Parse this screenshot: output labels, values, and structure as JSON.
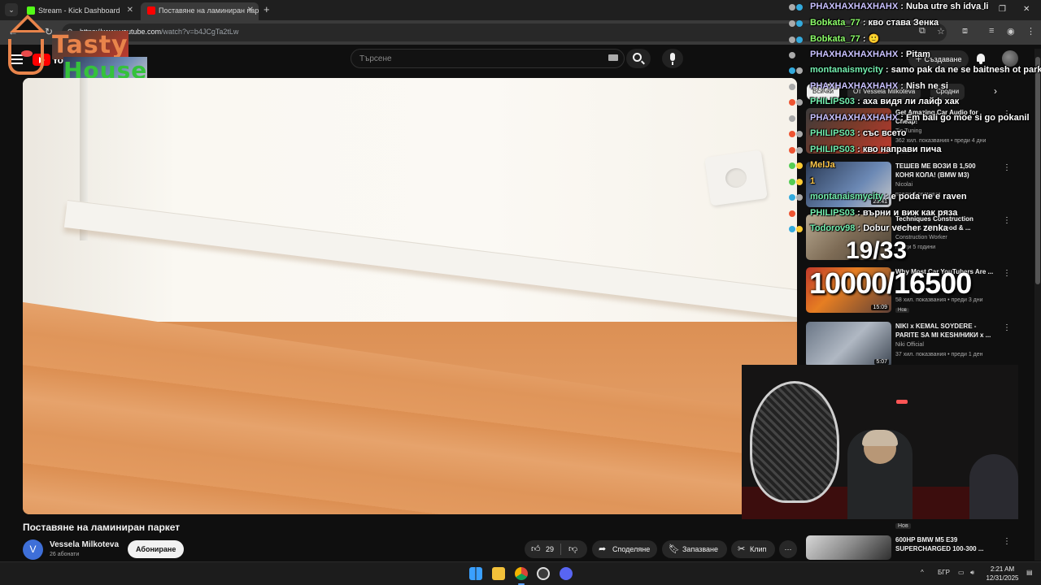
{
  "browser": {
    "tabs": [
      {
        "title": "Stream - Kick Dashboard",
        "color": "#53fc18"
      },
      {
        "title": "Поставяне на ламиниран парк",
        "color": "#ff0000"
      }
    ],
    "url_host": "https://www.youtube.com",
    "url_path": "/watch?v=b4JCgTa2tLw"
  },
  "youtube": {
    "logo_text": "YouTube",
    "search_placeholder": "Търсене",
    "create_label": "Създаване",
    "video": {
      "title": "Поставяне на ламиниран паркет",
      "channel": "Vessela Milkoteva",
      "channel_initial": "V",
      "subscribers": "26 абонати",
      "subscribe_label": "Абониране",
      "likes": "29",
      "share_label": "Споделяне",
      "save_label": "Запазване",
      "clip_label": "Клип"
    },
    "chips": [
      "Всички",
      "От Vessela Milkoteva",
      "Сродни"
    ],
    "recommendations": [
      {
        "title": "Get Amazing Car Audio for Cheap!",
        "channel": "Tie Tuning",
        "views": "362 хил. показвания",
        "age": "преди 4 дни",
        "duration": "",
        "badge": "Нов"
      },
      {
        "title": "ТЕШЕВ МЕ ВОЗИ В 1,500 КОНЯ КОЛА! (BMW M3)",
        "channel": "Nicolai",
        "views": "",
        "age": "преди 4 седмици",
        "duration": "23:41",
        "badge": ""
      },
      {
        "title": "Techniques Construction Workers With Wood & ...",
        "channel": "Construction Worker",
        "views": "",
        "age": "преди 5 години",
        "duration": "",
        "badge": ""
      },
      {
        "title": "Why Most Car YouTubers Are ...",
        "channel": "",
        "views": "58 хил. показвания",
        "age": "преди 3 дни",
        "duration": "15:09",
        "badge": "Нов"
      },
      {
        "title": "NIKI x KEMAL SOYDERE - PARITE SA MI KESH/НИКИ x ...",
        "channel": "Niki Official",
        "views": "37 хил. показвания",
        "age": "преди 1 ден",
        "duration": "5:07",
        "badge": ""
      },
      {
        "title": "600HP BMW M5 E39 SUPERCHARGED 100-300 ...",
        "channel": "",
        "views": "",
        "age": "",
        "duration": "",
        "badge": "Нов"
      }
    ]
  },
  "overlay": {
    "brand_top": "Tasty",
    "brand_bottom": "House",
    "counter1": "19/33",
    "counter2": "10000/16500"
  },
  "chat": [
    {
      "user": "PHAXHAXHAXHAHX",
      "msg": "Nuba utre sh idva li",
      "color": "#c9c1ff"
    },
    {
      "user": "Bobkata_77",
      "msg": "кво става Зенка",
      "color": "#8dff6a"
    },
    {
      "user": "Bobkata_77",
      "msg": "",
      "color": "#8dff6a"
    },
    {
      "user": "PHAXHAXHAXHAHX",
      "msg": "Pitam",
      "color": "#c9c1ff"
    },
    {
      "user": "montanaismycity",
      "msg": "samo pak da ne se baitnesh ot parketa",
      "color": "#74f0b0"
    },
    {
      "user": "PHAXHAXHAXHAHX",
      "msg": "Nish ne si",
      "color": "#c9c1ff"
    },
    {
      "user": "PHILIPS03",
      "msg": "аха видя ли лайф хак",
      "color": "#74f0b0"
    },
    {
      "user": "PHAXHAXHAXHAHX",
      "msg": "Em bali go moe si go pokanil",
      "color": "#c9c1ff"
    },
    {
      "user": "PHILIPS03",
      "msg": "със всето",
      "color": "#74f0b0"
    },
    {
      "user": "PHILIPS03",
      "msg": "кво направи пича",
      "color": "#74f0b0"
    },
    {
      "user": "MelJa",
      "msg": "",
      "color": "#ffc94d"
    },
    {
      "user": "1",
      "msg": "",
      "color": "#ffc94d"
    },
    {
      "user": "montanaismycity",
      "msg": "e poda ne e raven",
      "color": "#74f0b0"
    },
    {
      "user": "PHILIPS03",
      "msg": "върни и виж как ряза",
      "color": "#74f0b0"
    },
    {
      "user": "Todorov98",
      "msg": "Dobur vecher zenka",
      "color": "#74f0b0"
    }
  ],
  "taskbar": {
    "lang": "БГР",
    "time": "2:21 AM",
    "date": "12/31/2025"
  }
}
